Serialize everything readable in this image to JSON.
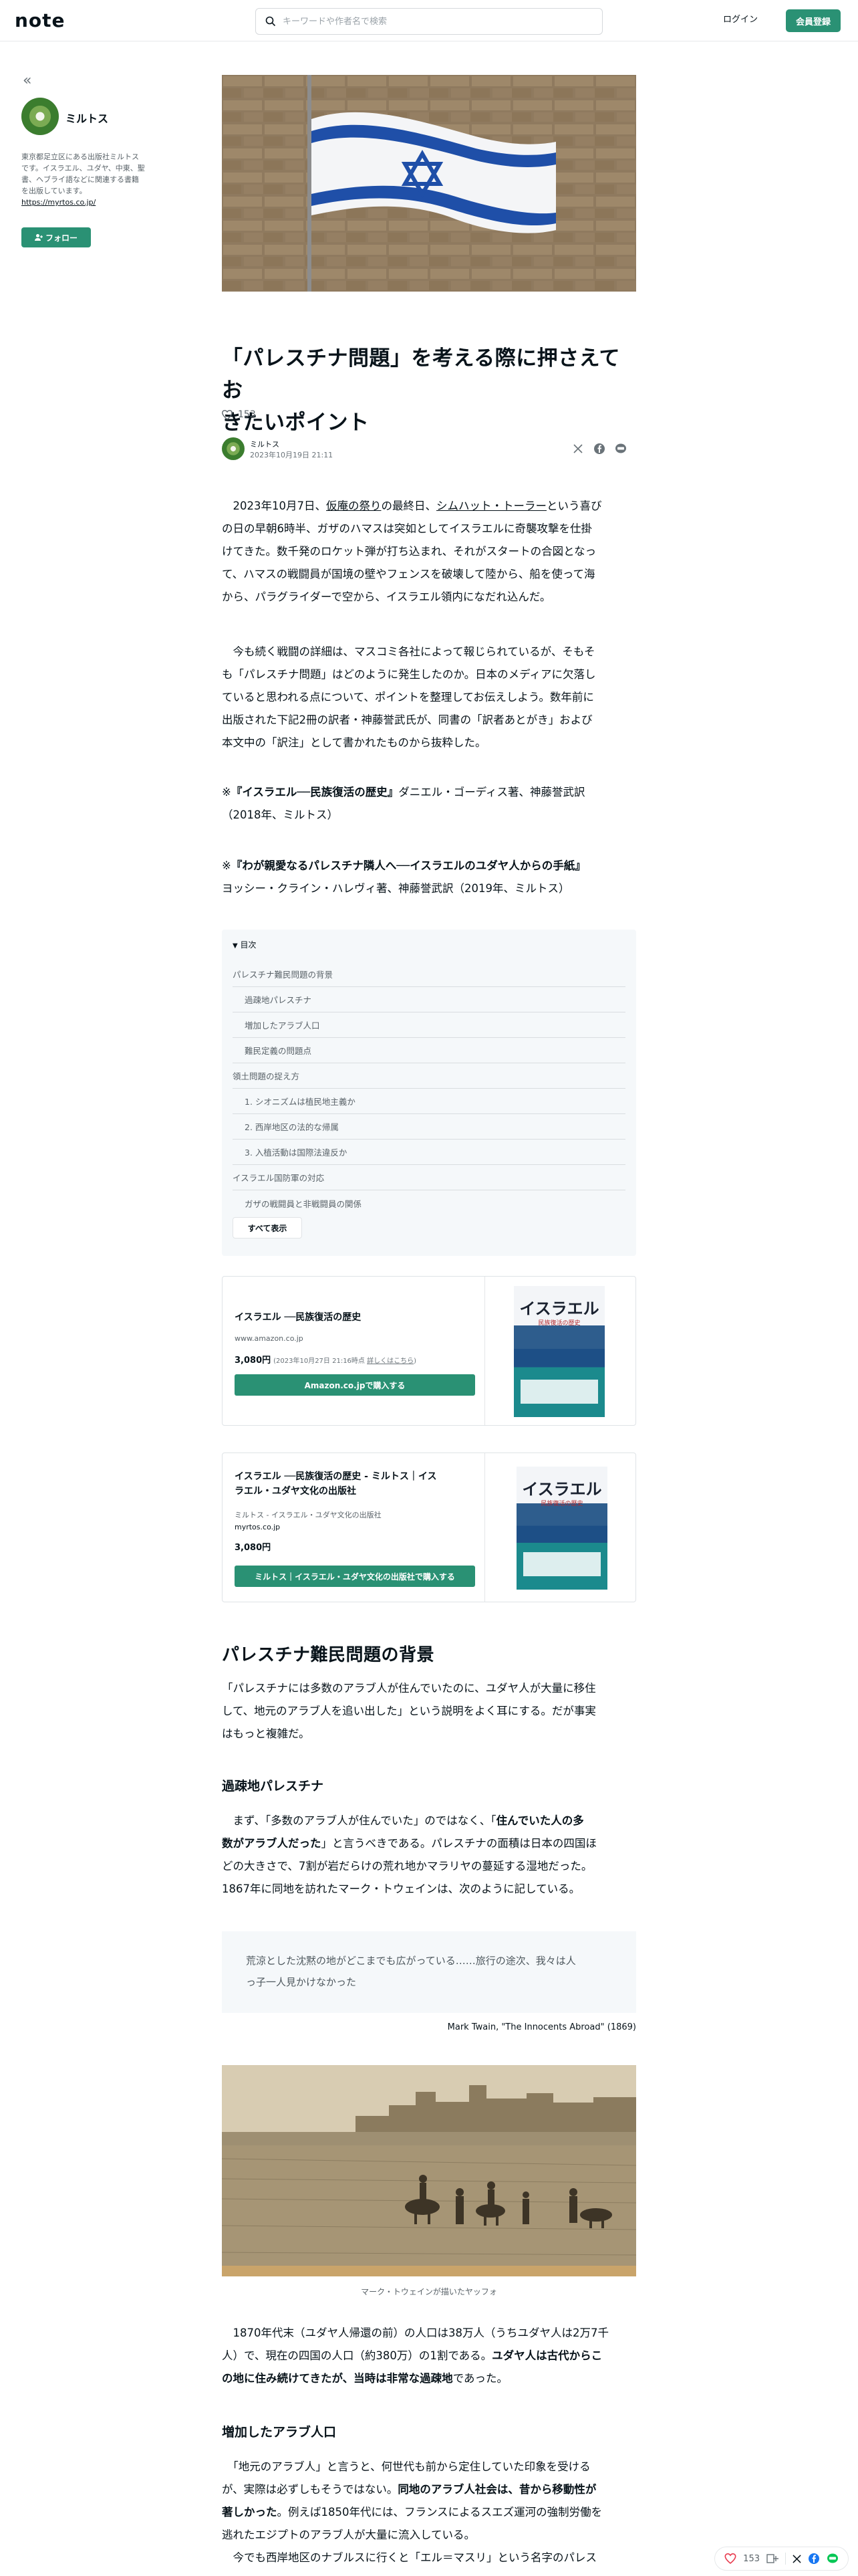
{
  "header": {
    "logo": "note",
    "search_placeholder": "キーワードや作者名で検索",
    "login": "ログイン",
    "register": "会員登録"
  },
  "sidebar": {
    "name": "ミルトス",
    "bio": "東京都足立区にある出版社ミルトスです。イスラエル、ユダヤ、中東、聖書、ヘブライ語などに関連する書籍を出版しています。",
    "link": "https://myrtos.co.jp/",
    "follow": "フォロー"
  },
  "article": {
    "title_line1": "「パレスチナ問題」を考える際に押さえてお",
    "title_line2": "きたいポイント",
    "likes": "153",
    "author": "ミルトス",
    "date": "2023年10月19日 21:11",
    "p1_a": "2023年10月7日、",
    "p1_link1": "仮庵の祭り",
    "p1_b": "の最終日、",
    "p1_link2": "シムハット・トーラー",
    "p1_c": "という喜び",
    "p1_l2": "の日の早朝6時半、ガザのハマスは突如としてイスラエルに奇襲攻撃を仕掛",
    "p1_l3": "けてきた。数千発のロケット弾が打ち込まれ、それがスタートの合図となっ",
    "p1_l4": "て、ハマスの戦闘員が国境の壁やフェンスを破壊して陸から、船を使って海",
    "p1_l5": "から、パラグライダーで空から、イスラエル領内になだれ込んだ。",
    "p2_l1": "今も続く戦闘の詳細は、マスコミ各社によって報じられているが、そもそ",
    "p2_l2": "も「パレスチナ問題」はどのように発生したのか。日本のメディアに欠落し",
    "p2_l3": "ていると思われる点について、ポイントを整理してお伝えしよう。数年前に",
    "p2_l4": "出版された下記2冊の訳者・神藤誉武氏が、同書の「訳者あとがき」および",
    "p2_l5": "本文中の「訳注」として書かれたものから抜粋した。",
    "ref1_mark": "※",
    "ref1_bold": "『イスラエル──民族復活の歴史』",
    "ref1_rest": "ダニエル・ゴーディス著、神藤誉武訳",
    "ref1_l2": "（2018年、ミルトス）",
    "ref2_mark": "※",
    "ref2_bold": "『わが親愛なるパレスチナ隣人へ──イスラエルのユダヤ人からの手紙』",
    "ref2_l2": "ヨッシー・クライン・ハレヴィ著、神藤誉武訳（2019年、ミルトス）"
  },
  "toc": {
    "heading": "目次",
    "items": [
      {
        "label": "パレスチナ難民問題の背景",
        "level": 1
      },
      {
        "label": "過疎地パレスチナ",
        "level": 2
      },
      {
        "label": "増加したアラブ人口",
        "level": 2
      },
      {
        "label": "難民定義の問題点",
        "level": 2
      },
      {
        "label": "領土問題の捉え方",
        "level": 1
      },
      {
        "label": "1. シオニズムは植民地主義か",
        "level": 2
      },
      {
        "label": "2. 西岸地区の法的な帰属",
        "level": 2
      },
      {
        "label": "3. 入植活動は国際法違反か",
        "level": 2
      },
      {
        "label": "イスラエル国防軍の対応",
        "level": 1
      },
      {
        "label": "ガザの戦闘員と非戦闘員の関係",
        "level": 2
      }
    ],
    "show_all": "すべて表示"
  },
  "card1": {
    "title": "イスラエル ──民族復活の歴史",
    "site": "www.amazon.co.jp",
    "price": "3,080円",
    "price_note": "(2023年10月27日 21:16時点",
    "price_link": "詳しくはこちら",
    "price_close": ")",
    "button": "Amazon.co.jpで購入する",
    "cover_title": "イスラエル",
    "cover_sub": "民族復活の歴史"
  },
  "card2": {
    "title_l1": "イスラエル ──民族復活の歴史 - ミルトス｜イス",
    "title_l2": "ラエル・ユダヤ文化の出版社",
    "site_name": "ミルトス - イスラエル・ユダヤ文化の出版社",
    "site": "myrtos.co.jp",
    "price": "3,080円",
    "button": "ミルトス｜イスラエル・ユダヤ文化の出版社で購入する",
    "cover_title": "イスラエル",
    "cover_sub": "民族復活の歴史"
  },
  "section1": {
    "heading": "パレスチナ難民問題の背景",
    "intro_l1": "「パレスチナには多数のアラブ人が住んでいたのに、ユダヤ人が大量に移住",
    "intro_l2": "して、地元のアラブ人を追い出した」という説明をよく耳にする。だが事実",
    "intro_l3": "はもっと複雑だ。",
    "sub1": "過疎地パレスチナ",
    "s1_a": "まず、「多数のアラブ人が住んでいた」のではなく、「",
    "s1_bold1": "住んでいた人の多",
    "s1_bold2": "数がアラブ人だった",
    "s1_b": "」と言うべきである。パレスチナの面積は日本の四国ほ",
    "s1_l3": "どの大きさで、7割が岩だらけの荒れ地かマラリヤの蔓延する湿地だった。",
    "s1_l4": "1867年に同地を訪れたマーク・トウェインは、次のように記している。",
    "quote_l1": "荒涼とした沈黙の地がどこまでも広がっている……旅行の途次、我々は人",
    "quote_l2": "っ子一人見かけなかった",
    "quote_cite": "Mark Twain, \"The Innocents Abroad\" (1869)",
    "caption": "マーク・トウェインが描いたヤッフォ",
    "p3_l1": "1870年代末（ユダヤ人帰還の前）の人口は38万人（うちユダヤ人は2万7千",
    "p3_a": "人）で、現在の四国の人口（約380万）の1割である。",
    "p3_bold1": "ユダヤ人は古代からこ",
    "p3_bold2": "の地に住み続けてきたが、当時は非常な過疎地",
    "p3_b": "であった。",
    "sub2": "増加したアラブ人口",
    "p4_l1": "「地元のアラブ人」と言うと、何世代も前から定住していた印象を受ける",
    "p4_a": "が、実際は必ずしもそうではない。",
    "p4_bold1": "同地のアラブ人社会は、昔から移動性が",
    "p4_bold2": "著しかった",
    "p4_b": "。例えば1850年代には、フランスによるスエズ運河の強制労働を",
    "p4_l4": "逃れたエジプトのアラブ人が大量に流入している。",
    "p5_l1": "今でも西岸地区のナブルスに行くと「エル＝マスリ」という名字のパレス"
  },
  "floatbar": {
    "likes": "153"
  },
  "colors": {
    "brand_green": "#2a9174",
    "text": "#08131a",
    "muted": "#5a6369"
  }
}
